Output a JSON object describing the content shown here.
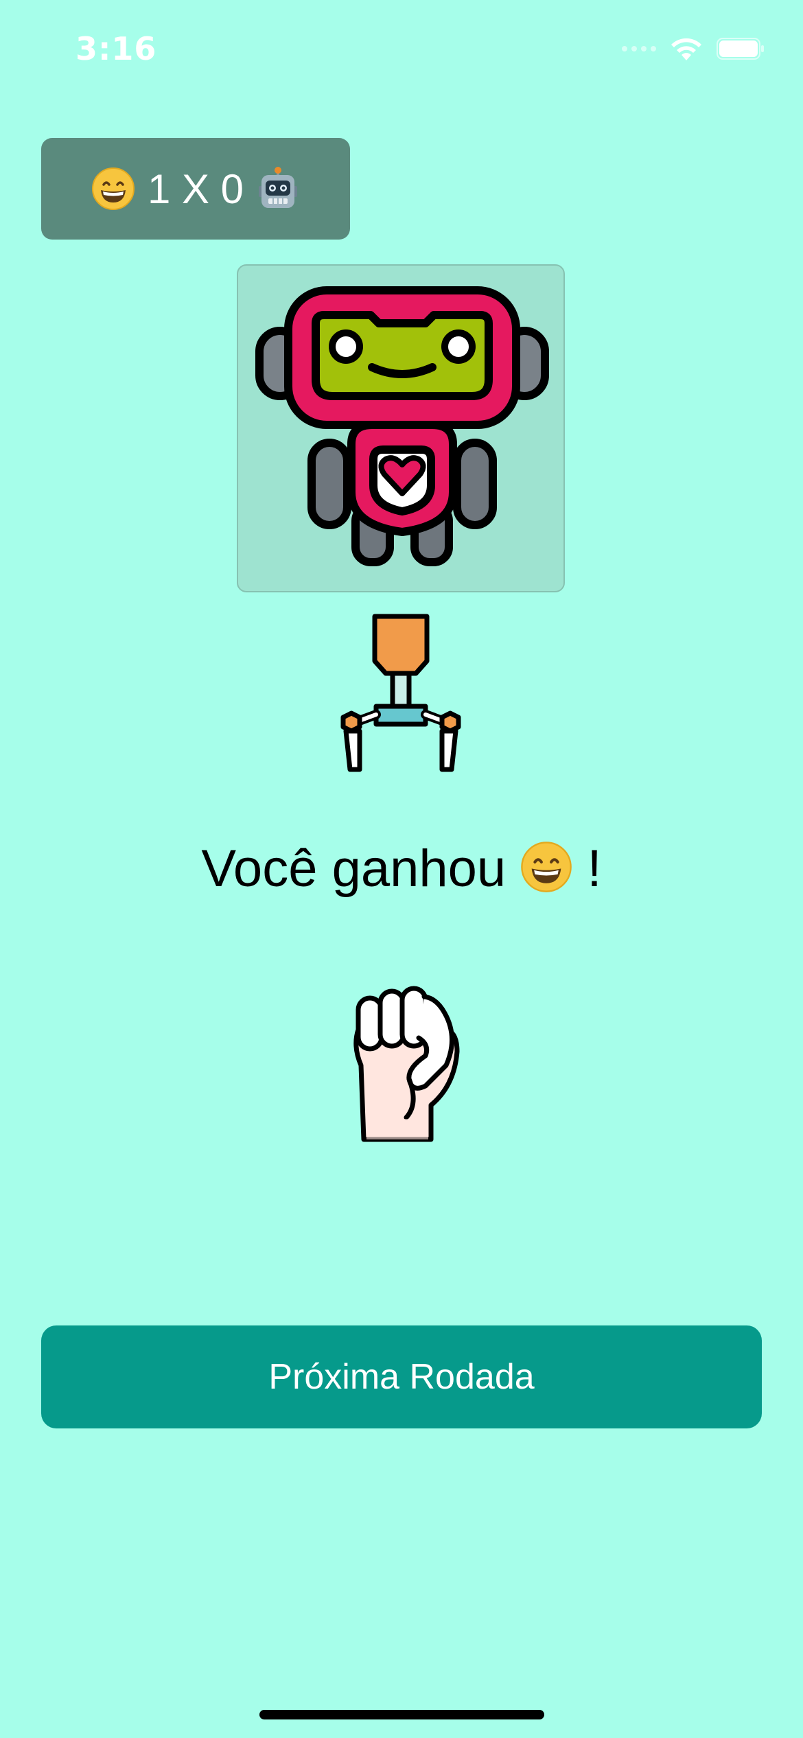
{
  "status_bar": {
    "time": "3:16"
  },
  "scoreboard": {
    "player_icon": "grinning-face-emoji",
    "score_text": "1 X 0",
    "robot_icon": "robot-face-emoji"
  },
  "opponent_card": {
    "icon": "robot-icon"
  },
  "robot_choice": {
    "icon": "robotic-claw-icon"
  },
  "result": {
    "text": "Você ganhou",
    "face_icon": "grinning-face-emoji",
    "suffix": "!"
  },
  "player_choice": {
    "icon": "fist-rock-icon"
  },
  "next_button": {
    "label": "Próxima Rodada"
  },
  "colors": {
    "background": "#a6feea",
    "scoreboard": "#5a8a7d",
    "button": "#069a8b",
    "robot_card": "#9ee3d0"
  }
}
